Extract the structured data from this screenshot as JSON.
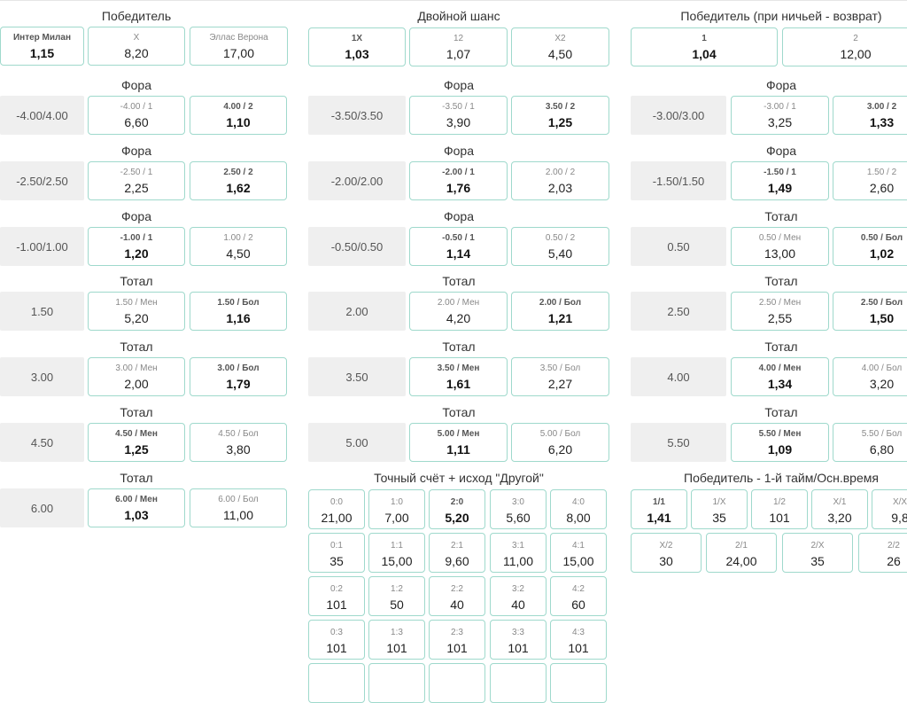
{
  "col1": {
    "header": {
      "title": "Победитель",
      "odds": [
        {
          "label": "Интер Милан",
          "value": "1,15",
          "bold": true
        },
        {
          "label": "X",
          "value": "8,20",
          "bold": false
        },
        {
          "label": "Эллас Верона",
          "value": "17,00",
          "bold": false
        }
      ]
    },
    "markets": [
      {
        "title": "Фора",
        "line": "-4.00/4.00",
        "odds": [
          {
            "label": "-4.00 / 1",
            "value": "6,60",
            "bold": false
          },
          {
            "label": "4.00 / 2",
            "value": "1,10",
            "bold": true
          }
        ]
      },
      {
        "title": "Фора",
        "line": "-2.50/2.50",
        "odds": [
          {
            "label": "-2.50 / 1",
            "value": "2,25",
            "bold": false
          },
          {
            "label": "2.50 / 2",
            "value": "1,62",
            "bold": true
          }
        ]
      },
      {
        "title": "Фора",
        "line": "-1.00/1.00",
        "odds": [
          {
            "label": "-1.00 / 1",
            "value": "1,20",
            "bold": true
          },
          {
            "label": "1.00 / 2",
            "value": "4,50",
            "bold": false
          }
        ]
      },
      {
        "title": "Тотал",
        "line": "1.50",
        "odds": [
          {
            "label": "1.50 / Мен",
            "value": "5,20",
            "bold": false
          },
          {
            "label": "1.50 / Бол",
            "value": "1,16",
            "bold": true
          }
        ]
      },
      {
        "title": "Тотал",
        "line": "3.00",
        "odds": [
          {
            "label": "3.00 / Мен",
            "value": "2,00",
            "bold": false
          },
          {
            "label": "3.00 / Бол",
            "value": "1,79",
            "bold": true
          }
        ]
      },
      {
        "title": "Тотал",
        "line": "4.50",
        "odds": [
          {
            "label": "4.50 / Мен",
            "value": "1,25",
            "bold": true
          },
          {
            "label": "4.50 / Бол",
            "value": "3,80",
            "bold": false
          }
        ]
      },
      {
        "title": "Тотал",
        "line": "6.00",
        "odds": [
          {
            "label": "6.00 / Мен",
            "value": "1,03",
            "bold": true
          },
          {
            "label": "6.00 / Бол",
            "value": "11,00",
            "bold": false
          }
        ]
      }
    ]
  },
  "col2": {
    "header": {
      "title": "Двойной шанс",
      "odds": [
        {
          "label": "1X",
          "value": "1,03",
          "bold": true
        },
        {
          "label": "12",
          "value": "1,07",
          "bold": false
        },
        {
          "label": "X2",
          "value": "4,50",
          "bold": false
        }
      ]
    },
    "markets": [
      {
        "title": "Фора",
        "line": "-3.50/3.50",
        "odds": [
          {
            "label": "-3.50 / 1",
            "value": "3,90",
            "bold": false
          },
          {
            "label": "3.50 / 2",
            "value": "1,25",
            "bold": true
          }
        ]
      },
      {
        "title": "Фора",
        "line": "-2.00/2.00",
        "odds": [
          {
            "label": "-2.00 / 1",
            "value": "1,76",
            "bold": true
          },
          {
            "label": "2.00 / 2",
            "value": "2,03",
            "bold": false
          }
        ]
      },
      {
        "title": "Фора",
        "line": "-0.50/0.50",
        "odds": [
          {
            "label": "-0.50 / 1",
            "value": "1,14",
            "bold": true
          },
          {
            "label": "0.50 / 2",
            "value": "5,40",
            "bold": false
          }
        ]
      },
      {
        "title": "Тотал",
        "line": "2.00",
        "odds": [
          {
            "label": "2.00 / Мен",
            "value": "4,20",
            "bold": false
          },
          {
            "label": "2.00 / Бол",
            "value": "1,21",
            "bold": true
          }
        ]
      },
      {
        "title": "Тотал",
        "line": "3.50",
        "odds": [
          {
            "label": "3.50 / Мен",
            "value": "1,61",
            "bold": true
          },
          {
            "label": "3.50 / Бол",
            "value": "2,27",
            "bold": false
          }
        ]
      },
      {
        "title": "Тотал",
        "line": "5.00",
        "odds": [
          {
            "label": "5.00 / Мен",
            "value": "1,11",
            "bold": true
          },
          {
            "label": "5.00 / Бол",
            "value": "6,20",
            "bold": false
          }
        ]
      }
    ],
    "correct_score": {
      "title": "Точный счёт + исход \"Другой\"",
      "rows": [
        [
          {
            "label": "0:0",
            "value": "21,00",
            "bold": false
          },
          {
            "label": "1:0",
            "value": "7,00",
            "bold": false
          },
          {
            "label": "2:0",
            "value": "5,20",
            "bold": true
          },
          {
            "label": "3:0",
            "value": "5,60",
            "bold": false
          },
          {
            "label": "4:0",
            "value": "8,00",
            "bold": false
          }
        ],
        [
          {
            "label": "0:1",
            "value": "35",
            "bold": false
          },
          {
            "label": "1:1",
            "value": "15,00",
            "bold": false
          },
          {
            "label": "2:1",
            "value": "9,60",
            "bold": false
          },
          {
            "label": "3:1",
            "value": "11,00",
            "bold": false
          },
          {
            "label": "4:1",
            "value": "15,00",
            "bold": false
          }
        ],
        [
          {
            "label": "0:2",
            "value": "101",
            "bold": false
          },
          {
            "label": "1:2",
            "value": "50",
            "bold": false
          },
          {
            "label": "2:2",
            "value": "40",
            "bold": false
          },
          {
            "label": "3:2",
            "value": "40",
            "bold": false
          },
          {
            "label": "4:2",
            "value": "60",
            "bold": false
          }
        ],
        [
          {
            "label": "0:3",
            "value": "101",
            "bold": false
          },
          {
            "label": "1:3",
            "value": "101",
            "bold": false
          },
          {
            "label": "2:3",
            "value": "101",
            "bold": false
          },
          {
            "label": "3:3",
            "value": "101",
            "bold": false
          },
          {
            "label": "4:3",
            "value": "101",
            "bold": false
          }
        ],
        [
          {
            "label": null,
            "value": null,
            "bold": false
          },
          {
            "label": null,
            "value": null,
            "bold": false
          },
          {
            "label": null,
            "value": null,
            "bold": false
          },
          {
            "label": null,
            "value": null,
            "bold": false
          },
          {
            "label": null,
            "value": null,
            "bold": false
          }
        ]
      ]
    }
  },
  "col3": {
    "header": {
      "title": "Победитель (при ничьей - возврат)",
      "odds": [
        {
          "label": "1",
          "value": "1,04",
          "bold": true
        },
        {
          "label": "2",
          "value": "12,00",
          "bold": false
        }
      ]
    },
    "markets": [
      {
        "title": "Фора",
        "line": "-3.00/3.00",
        "odds": [
          {
            "label": "-3.00 / 1",
            "value": "3,25",
            "bold": false
          },
          {
            "label": "3.00 / 2",
            "value": "1,33",
            "bold": true
          }
        ]
      },
      {
        "title": "Фора",
        "line": "-1.50/1.50",
        "odds": [
          {
            "label": "-1.50 / 1",
            "value": "1,49",
            "bold": true
          },
          {
            "label": "1.50 / 2",
            "value": "2,60",
            "bold": false
          }
        ]
      },
      {
        "title": "Тотал",
        "line": "0.50",
        "odds": [
          {
            "label": "0.50 / Мен",
            "value": "13,00",
            "bold": false
          },
          {
            "label": "0.50 / Бол",
            "value": "1,02",
            "bold": true
          }
        ]
      },
      {
        "title": "Тотал",
        "line": "2.50",
        "odds": [
          {
            "label": "2.50 / Мен",
            "value": "2,55",
            "bold": false
          },
          {
            "label": "2.50 / Бол",
            "value": "1,50",
            "bold": true
          }
        ]
      },
      {
        "title": "Тотал",
        "line": "4.00",
        "odds": [
          {
            "label": "4.00 / Мен",
            "value": "1,34",
            "bold": true
          },
          {
            "label": "4.00 / Бол",
            "value": "3,20",
            "bold": false
          }
        ]
      },
      {
        "title": "Тотал",
        "line": "5.50",
        "odds": [
          {
            "label": "5.50 / Мен",
            "value": "1,09",
            "bold": true
          },
          {
            "label": "5.50 / Бол",
            "value": "6,80",
            "bold": false
          }
        ]
      }
    ],
    "half_full": {
      "title": "Победитель - 1-й тайм/Осн.время",
      "row1": [
        {
          "label": "1/1",
          "value": "1,41",
          "bold": true
        },
        {
          "label": "1/X",
          "value": "35",
          "bold": false
        },
        {
          "label": "1/2",
          "value": "101",
          "bold": false
        },
        {
          "label": "X/1",
          "value": "3,20",
          "bold": false
        },
        {
          "label": "X/X",
          "value": "9,8",
          "bold": false
        }
      ],
      "row2": [
        {
          "label": "X/2",
          "value": "30",
          "bold": false
        },
        {
          "label": "2/1",
          "value": "24,00",
          "bold": false
        },
        {
          "label": "2/X",
          "value": "35",
          "bold": false
        },
        {
          "label": "2/2",
          "value": "26",
          "bold": false
        }
      ]
    }
  },
  "colors": {
    "border": "#9fd9cc",
    "line_bg": "#efefef",
    "text": "#222222",
    "muted": "#888888"
  }
}
